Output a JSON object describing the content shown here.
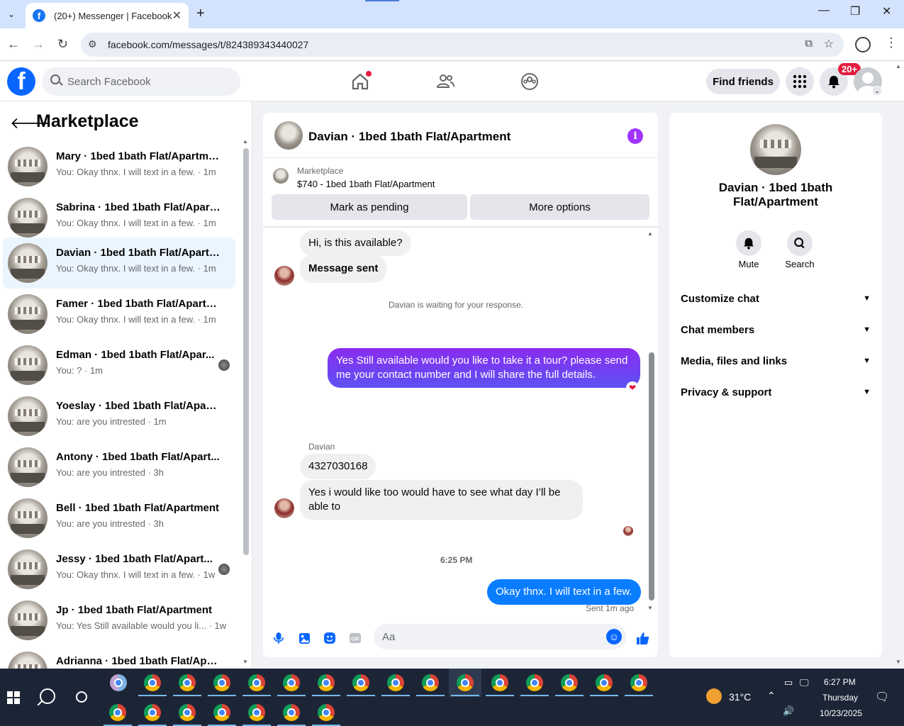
{
  "browser": {
    "tab_title": "(20+) Messenger | Facebook",
    "url": "facebook.com/messages/t/824389343440027"
  },
  "header": {
    "search_placeholder": "Search Facebook",
    "find_friends": "Find friends",
    "notif_badge": "20+"
  },
  "sidebar": {
    "title": "Marketplace",
    "conversations": [
      {
        "name": "Mary · 1bed 1bath Flat/Apartment",
        "preview": "You: Okay thnx. I will text in a few. · 1m",
        "active": false
      },
      {
        "name": "Sabrina · 1bed 1bath Flat/Apart...",
        "preview": "You: Okay thnx. I will text in a few. · 1m",
        "active": false
      },
      {
        "name": "Davian · 1bed 1bath Flat/Apartm...",
        "preview": "You: Okay thnx. I will text in a few. · 1m",
        "active": true
      },
      {
        "name": "Famer · 1bed 1bath Flat/Apartm...",
        "preview": "You: Okay thnx. I will text in a few. · 1m",
        "active": false
      },
      {
        "name": "Edman · 1bed 1bath Flat/Apar...",
        "preview": "You: ? · 1m",
        "active": false
      },
      {
        "name": "Yoeslay · 1bed 1bath Flat/Apart...",
        "preview": "You: are you intrested · 1m",
        "active": false
      },
      {
        "name": "Antony · 1bed 1bath Flat/Apart...",
        "preview": "You: are you intrested · 3h",
        "active": false
      },
      {
        "name": "Bell · 1bed 1bath Flat/Apartment",
        "preview": "You: are you intrested · 3h",
        "active": false
      },
      {
        "name": "Jessy · 1bed 1bath Flat/Apart...",
        "preview": "You: Okay thnx. I will text in a few. · 1w",
        "active": false
      },
      {
        "name": "Jp · 1bed 1bath Flat/Apartment",
        "preview": "You: Yes Still available would you li... · 1w",
        "active": false
      },
      {
        "name": "Adrianna · 1bed 1bath Flat/Apart...",
        "preview": "",
        "active": false
      }
    ]
  },
  "chat": {
    "title": "Davian · 1bed 1bath Flat/Apartment",
    "marketplace_label": "Marketplace",
    "listing": "$740 - 1bed 1bath Flat/Apartment",
    "mark_pending": "Mark as pending",
    "more_options": "More options",
    "msg1": "Hi, is this available?",
    "msg2": "Message sent",
    "waiting": "Davian is waiting for your response.",
    "msg3": "Yes Still available would you like to take it a tour? please send me your contact number and I will share the full details.",
    "sender": "Davian",
    "msg4": "4327030168",
    "msg5": "Yes i would like too would have to see what day I’ll be able to",
    "time": "6:25 PM",
    "msg6": "Okay thnx. I will text in a few.",
    "sent_status": "Sent 1m ago",
    "composer_placeholder": "Aa"
  },
  "info": {
    "title": "Davian · 1bed 1bath Flat/Apartment",
    "mute": "Mute",
    "search": "Search",
    "rows": [
      "Customize chat",
      "Chat members",
      "Media, files and links",
      "Privacy & support"
    ]
  },
  "taskbar": {
    "temp": "31°C",
    "time": "6:27 PM",
    "day": "Thursday",
    "date": "10/23/2025"
  }
}
